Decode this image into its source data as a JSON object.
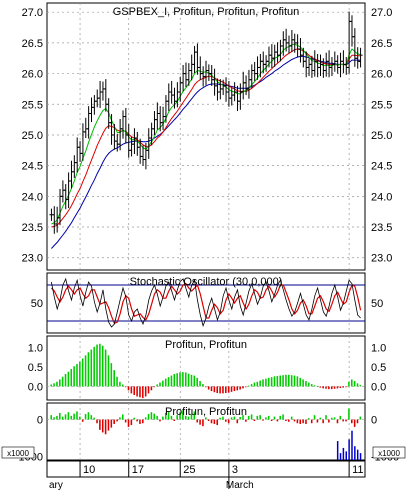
{
  "chart_data": [
    {
      "panel": "price",
      "type": "ohlc",
      "title": "GSPBEX_I, Profitun, Profitun, Profitun",
      "ylim": [
        22.8,
        27.15
      ],
      "yticks": [
        "23.0",
        "23.5",
        "24.0",
        "24.5",
        "25.0",
        "25.5",
        "26.0",
        "26.5",
        "27.0"
      ],
      "ytick_values": [
        23.0,
        23.5,
        24.0,
        24.5,
        25.0,
        25.5,
        26.0,
        26.5,
        27.0
      ],
      "grid": true,
      "colors": {
        "bars": "#000000",
        "line_green": "#00bb00",
        "line_red": "#dd0000",
        "line_blue": "#0000aa"
      },
      "close": [
        23.7,
        23.55,
        23.65,
        24.0,
        24.1,
        23.95,
        24.25,
        24.4,
        24.55,
        24.8,
        24.7,
        25.05,
        25.1,
        25.35,
        25.45,
        25.55,
        25.6,
        25.7,
        25.75,
        25.5,
        25.2,
        25.0,
        24.9,
        24.85,
        25.1,
        25.3,
        25.0,
        24.75,
        24.85,
        24.95,
        24.8,
        24.65,
        24.6,
        24.75,
        24.95,
        25.1,
        25.25,
        25.35,
        25.2,
        25.3,
        25.55,
        25.7,
        25.65,
        25.55,
        25.7,
        25.85,
        26.0,
        25.9,
        26.05,
        26.15,
        26.35,
        26.1,
        26.0,
        25.95,
        26.05,
        26.0,
        25.9,
        25.8,
        25.7,
        25.75,
        25.8,
        25.7,
        25.6,
        25.65,
        25.7,
        25.55,
        25.7,
        25.85,
        25.75,
        25.9,
        26.05,
        26.0,
        26.1,
        26.2,
        26.15,
        26.2,
        26.3,
        26.25,
        26.35,
        26.3,
        26.45,
        26.55,
        26.5,
        26.45,
        26.55,
        26.5,
        26.4,
        26.3,
        26.2,
        26.1,
        26.15,
        26.05,
        26.2,
        26.1,
        26.15,
        26.05,
        26.2,
        26.1,
        26.15,
        26.2,
        26.1,
        26.2,
        26.15,
        26.1,
        26.85,
        26.6,
        26.25,
        26.2,
        26.3
      ],
      "ma_green": [
        23.55,
        23.57,
        23.62,
        23.73,
        23.84,
        23.92,
        24.02,
        24.13,
        24.25,
        24.39,
        24.49,
        24.62,
        24.74,
        24.88,
        25.01,
        25.13,
        25.23,
        25.32,
        25.4,
        25.43,
        25.36,
        25.24,
        25.14,
        25.04,
        25.04,
        25.08,
        25.05,
        24.97,
        24.92,
        24.93,
        24.9,
        24.85,
        24.79,
        24.77,
        24.82,
        24.89,
        24.98,
        25.08,
        25.12,
        25.18,
        25.27,
        25.38,
        25.45,
        25.49,
        25.55,
        25.63,
        25.71,
        25.77,
        25.84,
        25.91,
        26.0,
        26.05,
        26.04,
        26.02,
        26.03,
        26.01,
        25.97,
        25.92,
        25.87,
        25.83,
        25.81,
        25.78,
        25.74,
        25.71,
        25.7,
        25.67,
        25.67,
        25.71,
        25.72,
        25.76,
        25.82,
        25.87,
        25.93,
        26.0,
        26.05,
        26.1,
        26.16,
        26.2,
        26.25,
        26.27,
        26.31,
        26.38,
        26.42,
        26.44,
        26.47,
        26.48,
        26.46,
        26.43,
        26.38,
        26.32,
        26.27,
        26.21,
        26.2,
        26.17,
        26.16,
        26.13,
        26.14,
        26.13,
        26.13,
        26.15,
        26.14,
        26.15,
        26.15,
        26.14,
        26.31,
        26.4,
        26.36,
        26.32,
        26.31
      ],
      "ma_red": [
        23.5,
        23.51,
        23.53,
        23.58,
        23.64,
        23.7,
        23.77,
        23.85,
        23.94,
        24.04,
        24.13,
        24.24,
        24.35,
        24.47,
        24.59,
        24.71,
        24.83,
        24.93,
        25.03,
        25.11,
        25.15,
        25.14,
        25.12,
        25.08,
        25.06,
        25.07,
        25.06,
        25.01,
        24.97,
        24.95,
        24.92,
        24.88,
        24.84,
        24.81,
        24.81,
        24.84,
        24.89,
        24.95,
        24.99,
        25.05,
        25.12,
        25.2,
        25.27,
        25.33,
        25.39,
        25.46,
        25.53,
        25.6,
        25.67,
        25.74,
        25.82,
        25.87,
        25.9,
        25.92,
        25.94,
        25.96,
        25.95,
        25.93,
        25.9,
        25.88,
        25.86,
        25.83,
        25.8,
        25.77,
        25.75,
        25.72,
        25.71,
        25.71,
        25.71,
        25.73,
        25.76,
        25.8,
        25.84,
        25.89,
        25.94,
        25.99,
        26.04,
        26.08,
        26.13,
        26.17,
        26.21,
        26.26,
        26.3,
        26.33,
        26.36,
        26.39,
        26.4,
        26.39,
        26.37,
        26.34,
        26.3,
        26.26,
        26.24,
        26.21,
        26.19,
        26.17,
        26.16,
        26.15,
        26.15,
        26.15,
        26.14,
        26.15,
        26.15,
        26.14,
        26.24,
        26.3,
        26.3,
        26.29,
        26.29
      ],
      "ma_blue": [
        23.15,
        23.2,
        23.25,
        23.31,
        23.37,
        23.43,
        23.5,
        23.57,
        23.65,
        23.73,
        23.81,
        23.9,
        23.99,
        24.08,
        24.18,
        24.27,
        24.37,
        24.46,
        24.56,
        24.64,
        24.7,
        24.74,
        24.77,
        24.79,
        24.82,
        24.85,
        24.87,
        24.88,
        24.89,
        24.9,
        24.9,
        24.9,
        24.89,
        24.89,
        24.9,
        24.92,
        24.95,
        24.98,
        25.01,
        25.05,
        25.1,
        25.15,
        25.2,
        25.25,
        25.3,
        25.36,
        25.42,
        25.47,
        25.53,
        25.59,
        25.65,
        25.7,
        25.74,
        25.77,
        25.8,
        25.82,
        25.83,
        25.83,
        25.83,
        25.82,
        25.82,
        25.81,
        25.8,
        25.79,
        25.78,
        25.76,
        25.76,
        25.76,
        25.76,
        25.77,
        25.79,
        25.81,
        25.84,
        25.87,
        25.9,
        25.94,
        25.97,
        26.0,
        26.04,
        26.07,
        26.1,
        26.14,
        26.17,
        26.2,
        26.23,
        26.25,
        26.27,
        26.28,
        26.28,
        26.27,
        26.26,
        26.24,
        26.23,
        26.22,
        26.2,
        26.19,
        26.18,
        26.17,
        26.17,
        26.16,
        26.15,
        26.15,
        26.15,
        26.14,
        26.18,
        26.22,
        26.22,
        26.22,
        26.22
      ]
    },
    {
      "panel": "stochastic",
      "type": "line",
      "title": "Stochastic Oscillator (30,0,000)",
      "ylim": [
        0,
        100
      ],
      "yticks": [
        "50"
      ],
      "ytick_values": [
        50
      ],
      "levels": [
        80,
        20
      ],
      "colors": {
        "k": "#000000",
        "d": "#dd0000",
        "levels": "#000088"
      },
      "k": [
        85,
        60,
        40,
        55,
        80,
        90,
        70,
        55,
        75,
        88,
        62,
        45,
        68,
        85,
        78,
        52,
        35,
        50,
        72,
        40,
        18,
        10,
        15,
        35,
        55,
        75,
        60,
        30,
        20,
        35,
        40,
        25,
        15,
        30,
        55,
        70,
        80,
        65,
        45,
        60,
        78,
        85,
        70,
        55,
        72,
        86,
        90,
        74,
        60,
        80,
        88,
        55,
        30,
        12,
        25,
        45,
        58,
        40,
        22,
        35,
        62,
        75,
        55,
        40,
        60,
        72,
        45,
        30,
        50,
        70,
        82,
        65,
        48,
        60,
        78,
        85,
        70,
        52,
        65,
        80,
        88,
        72,
        55,
        40,
        28,
        35,
        50,
        66,
        48,
        30,
        22,
        40,
        62,
        75,
        55,
        35,
        28,
        45,
        66,
        80,
        60,
        38,
        50,
        70,
        88,
        82,
        55,
        30,
        25
      ],
      "d": [
        75,
        70,
        60,
        52,
        60,
        72,
        78,
        72,
        65,
        72,
        75,
        65,
        58,
        62,
        72,
        72,
        60,
        48,
        50,
        52,
        42,
        28,
        16,
        18,
        32,
        52,
        62,
        58,
        40,
        28,
        30,
        32,
        26,
        22,
        32,
        48,
        65,
        72,
        68,
        58,
        58,
        70,
        78,
        72,
        65,
        70,
        80,
        82,
        75,
        70,
        75,
        80,
        65,
        45,
        25,
        25,
        38,
        48,
        42,
        32,
        38,
        55,
        65,
        58,
        50,
        58,
        62,
        50,
        40,
        48,
        62,
        72,
        68,
        58,
        60,
        72,
        78,
        70,
        60,
        68,
        80,
        80,
        68,
        55,
        40,
        32,
        38,
        50,
        55,
        45,
        32,
        32,
        45,
        58,
        62,
        52,
        40,
        36,
        48,
        62,
        68,
        58,
        48,
        52,
        68,
        80,
        78,
        60,
        38
      ]
    },
    {
      "panel": "profitun_1",
      "type": "bar",
      "title": "Profitun, Profitun",
      "ylim": [
        -0.35,
        1.3
      ],
      "yticks": [
        "1.0",
        "0.5",
        "0.0"
      ],
      "ytick_values": [
        1.0,
        0.5,
        0.0
      ],
      "colors": {
        "positive": "#00cc00",
        "negative": "#dd0000"
      },
      "values": [
        0.05,
        0.08,
        0.12,
        0.18,
        0.25,
        0.32,
        0.38,
        0.45,
        0.52,
        0.58,
        0.64,
        0.72,
        0.8,
        0.88,
        0.95,
        1.02,
        1.08,
        1.1,
        1.05,
        0.95,
        0.8,
        0.6,
        0.42,
        0.25,
        0.12,
        0.05,
        -0.02,
        -0.1,
        -0.18,
        -0.22,
        -0.26,
        -0.28,
        -0.3,
        -0.26,
        -0.18,
        -0.1,
        -0.02,
        0.05,
        0.1,
        0.15,
        0.2,
        0.24,
        0.28,
        0.32,
        0.34,
        0.36,
        0.37,
        0.36,
        0.33,
        0.3,
        0.28,
        0.22,
        0.14,
        0.06,
        -0.02,
        -0.08,
        -0.12,
        -0.15,
        -0.17,
        -0.18,
        -0.18,
        -0.17,
        -0.16,
        -0.14,
        -0.12,
        -0.1,
        -0.08,
        -0.05,
        -0.02,
        0.02,
        0.06,
        0.1,
        0.12,
        0.15,
        0.18,
        0.2,
        0.22,
        0.24,
        0.26,
        0.27,
        0.28,
        0.29,
        0.3,
        0.3,
        0.29,
        0.28,
        0.26,
        0.22,
        0.18,
        0.14,
        0.1,
        0.06,
        0.03,
        0.0,
        -0.03,
        -0.05,
        -0.06,
        -0.07,
        -0.07,
        -0.06,
        -0.05,
        -0.04,
        -0.03,
        -0.02,
        0.12,
        0.18,
        0.14,
        0.08,
        0.04
      ]
    },
    {
      "panel": "profitun_2",
      "type": "bar",
      "title": "Profitun, Profitun",
      "ylim": [
        -1.1,
        0.45
      ],
      "yticks": [
        "0",
        "-1000"
      ],
      "ytick_values": [
        0,
        -1.0
      ],
      "scale_label": "x1000",
      "colors": {
        "positive": "#00cc00",
        "negative": "#dd0000",
        "volume": "#0000cc"
      },
      "values": [
        0.12,
        0.06,
        0.1,
        0.18,
        0.08,
        0.14,
        0.2,
        0.1,
        0.16,
        0.22,
        0.08,
        -0.06,
        0.15,
        0.2,
        0.12,
        0.05,
        -0.1,
        -0.28,
        -0.35,
        -0.4,
        -0.3,
        -0.22,
        -0.12,
        -0.05,
        0.06,
        0.14,
        -0.08,
        -0.2,
        -0.15,
        0.05,
        -0.05,
        -0.12,
        -0.1,
        0.06,
        0.15,
        0.2,
        0.16,
        0.1,
        -0.05,
        0.08,
        0.18,
        0.22,
        0.1,
        -0.04,
        0.12,
        0.2,
        0.25,
        0.1,
        0.08,
        0.16,
        0.22,
        -0.08,
        -0.14,
        -0.18,
        0.06,
        -0.04,
        -0.1,
        -0.12,
        -0.15,
        0.05,
        0.08,
        -0.06,
        -0.1,
        0.06,
        0.08,
        -0.1,
        0.07,
        0.12,
        -0.06,
        0.1,
        0.14,
        -0.04,
        0.1,
        0.12,
        -0.03,
        0.06,
        0.1,
        -0.04,
        0.08,
        -0.05,
        0.1,
        0.14,
        -0.04,
        -0.06,
        0.08,
        -0.05,
        -0.1,
        -0.12,
        -0.1,
        -0.12,
        0.04,
        -0.1,
        0.12,
        -0.08,
        0.05,
        -0.1,
        0.12,
        -0.08,
        0.05,
        0.06,
        -0.1,
        0.1,
        -0.05,
        -0.05,
        0.3,
        -0.1,
        -0.2,
        -0.1,
        0.08
      ],
      "volume_spikes": [
        0,
        0,
        0,
        0,
        0,
        0,
        0,
        0,
        0,
        0,
        0,
        0,
        0,
        0,
        0,
        0,
        0,
        0,
        0,
        0,
        0,
        0,
        0,
        0,
        0,
        0,
        0,
        0,
        0,
        0,
        0,
        0,
        0,
        0,
        0,
        0,
        0,
        0,
        0,
        0,
        0,
        0,
        0,
        0,
        0,
        0,
        0,
        0,
        0,
        0,
        0,
        0,
        0,
        0,
        0,
        0,
        0,
        0,
        0,
        0,
        0,
        0,
        0,
        0,
        0,
        0,
        0,
        0,
        0,
        0,
        0,
        0,
        0,
        0,
        0,
        0,
        0,
        0,
        0,
        0,
        0,
        0,
        0,
        0,
        0,
        0,
        0,
        0,
        0,
        0,
        0,
        0,
        0,
        0,
        0,
        0,
        0,
        0,
        0,
        0,
        0.55,
        0.2,
        0.35,
        0.25,
        0.6,
        0.85,
        0.4,
        0.3,
        0.2
      ]
    }
  ],
  "x_axis": {
    "tick_labels": [
      "10",
      "17",
      "25",
      "3",
      "11"
    ],
    "tick_index": [
      10,
      27,
      45,
      62,
      104
    ],
    "month_labels": [
      "ary",
      "March"
    ],
    "month_index": [
      0,
      62
    ]
  }
}
